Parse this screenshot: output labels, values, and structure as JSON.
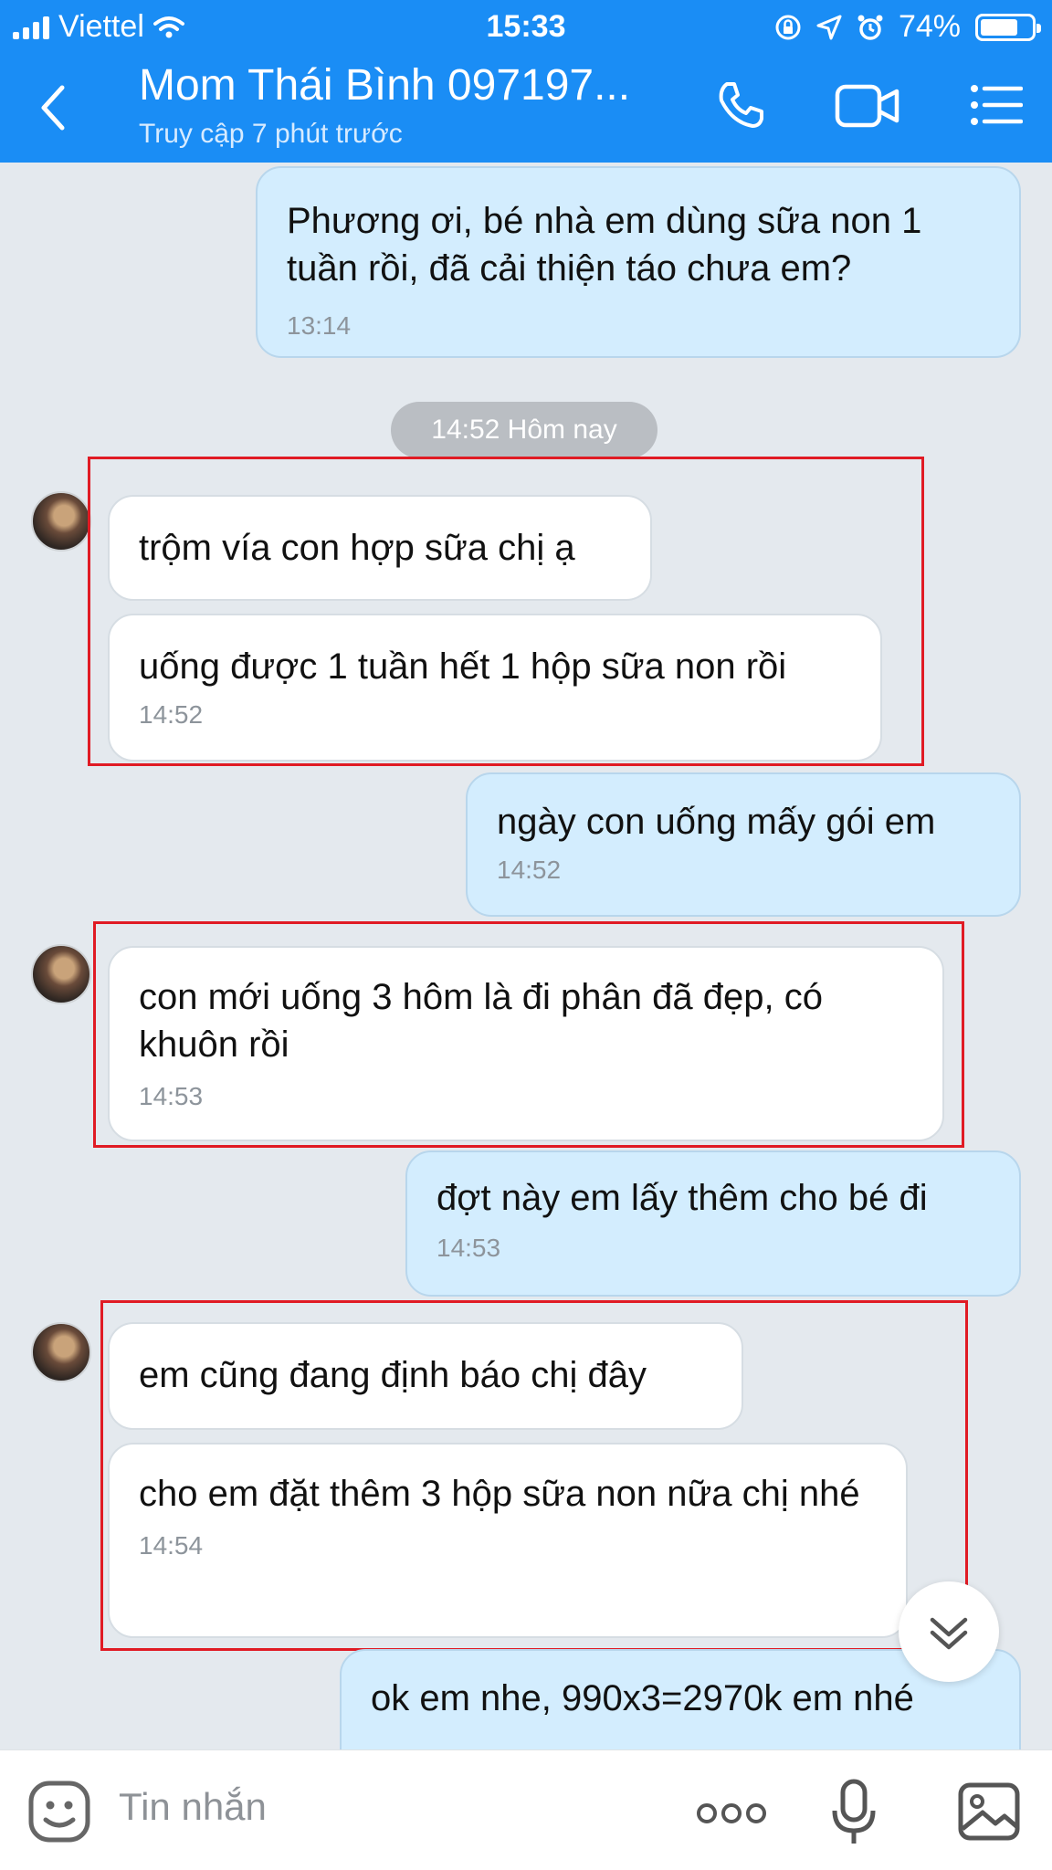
{
  "status_bar": {
    "carrier": "Viettel",
    "time": "15:33",
    "battery": "74%",
    "battery_level": 0.74,
    "icons": [
      "signal-icon",
      "wifi-icon",
      "rotation-lock-icon",
      "location-icon",
      "alarm-icon",
      "battery-icon"
    ]
  },
  "header": {
    "title": "Mom Thái Bình 097197...",
    "subtitle": "Truy cập 7 phút trước",
    "icons": [
      "back-chevron-icon",
      "phone-icon",
      "video-call-icon",
      "menu-list-icon"
    ]
  },
  "chat": {
    "date_separator": "14:52 Hôm nay",
    "messages": [
      {
        "side": "sent",
        "text": "Phương ơi, bé nhà em dùng sữa non 1 tuần rồi, đã cải thiện táo chưa em?",
        "time": "13:14"
      },
      {
        "side": "received",
        "text": "trộm vía con hợp sữa chị ạ",
        "time": ""
      },
      {
        "side": "received",
        "text": "uống được 1 tuần hết 1 hộp sữa non rồi",
        "time": "14:52"
      },
      {
        "side": "sent",
        "text": "ngày con uống mấy gói em",
        "time": "14:52"
      },
      {
        "side": "received",
        "text": "con mới uống 3 hôm là đi phân đã đẹp, có khuôn rồi",
        "time": "14:53"
      },
      {
        "side": "sent",
        "text": "đợt này em lấy thêm cho bé đi",
        "time": "14:53"
      },
      {
        "side": "received",
        "text": "em cũng đang định báo chị đây",
        "time": ""
      },
      {
        "side": "received",
        "text": "cho em đặt thêm 3 hộp sữa non nữa chị nhé",
        "time": "14:54"
      },
      {
        "side": "sent",
        "text": "ok em nhe, 990x3=2970k em nhé",
        "time": ""
      }
    ]
  },
  "composer": {
    "placeholder": "Tin nhắn",
    "icons": [
      "emoji-icon",
      "more-dots-icon",
      "microphone-icon",
      "image-icon"
    ]
  },
  "colors": {
    "header_blue": "#1a8df5",
    "sent_bubble": "#d3edfe",
    "received_bubble": "#ffffff",
    "chat_background": "#e4e9ee",
    "highlight_red": "#e01b24"
  }
}
